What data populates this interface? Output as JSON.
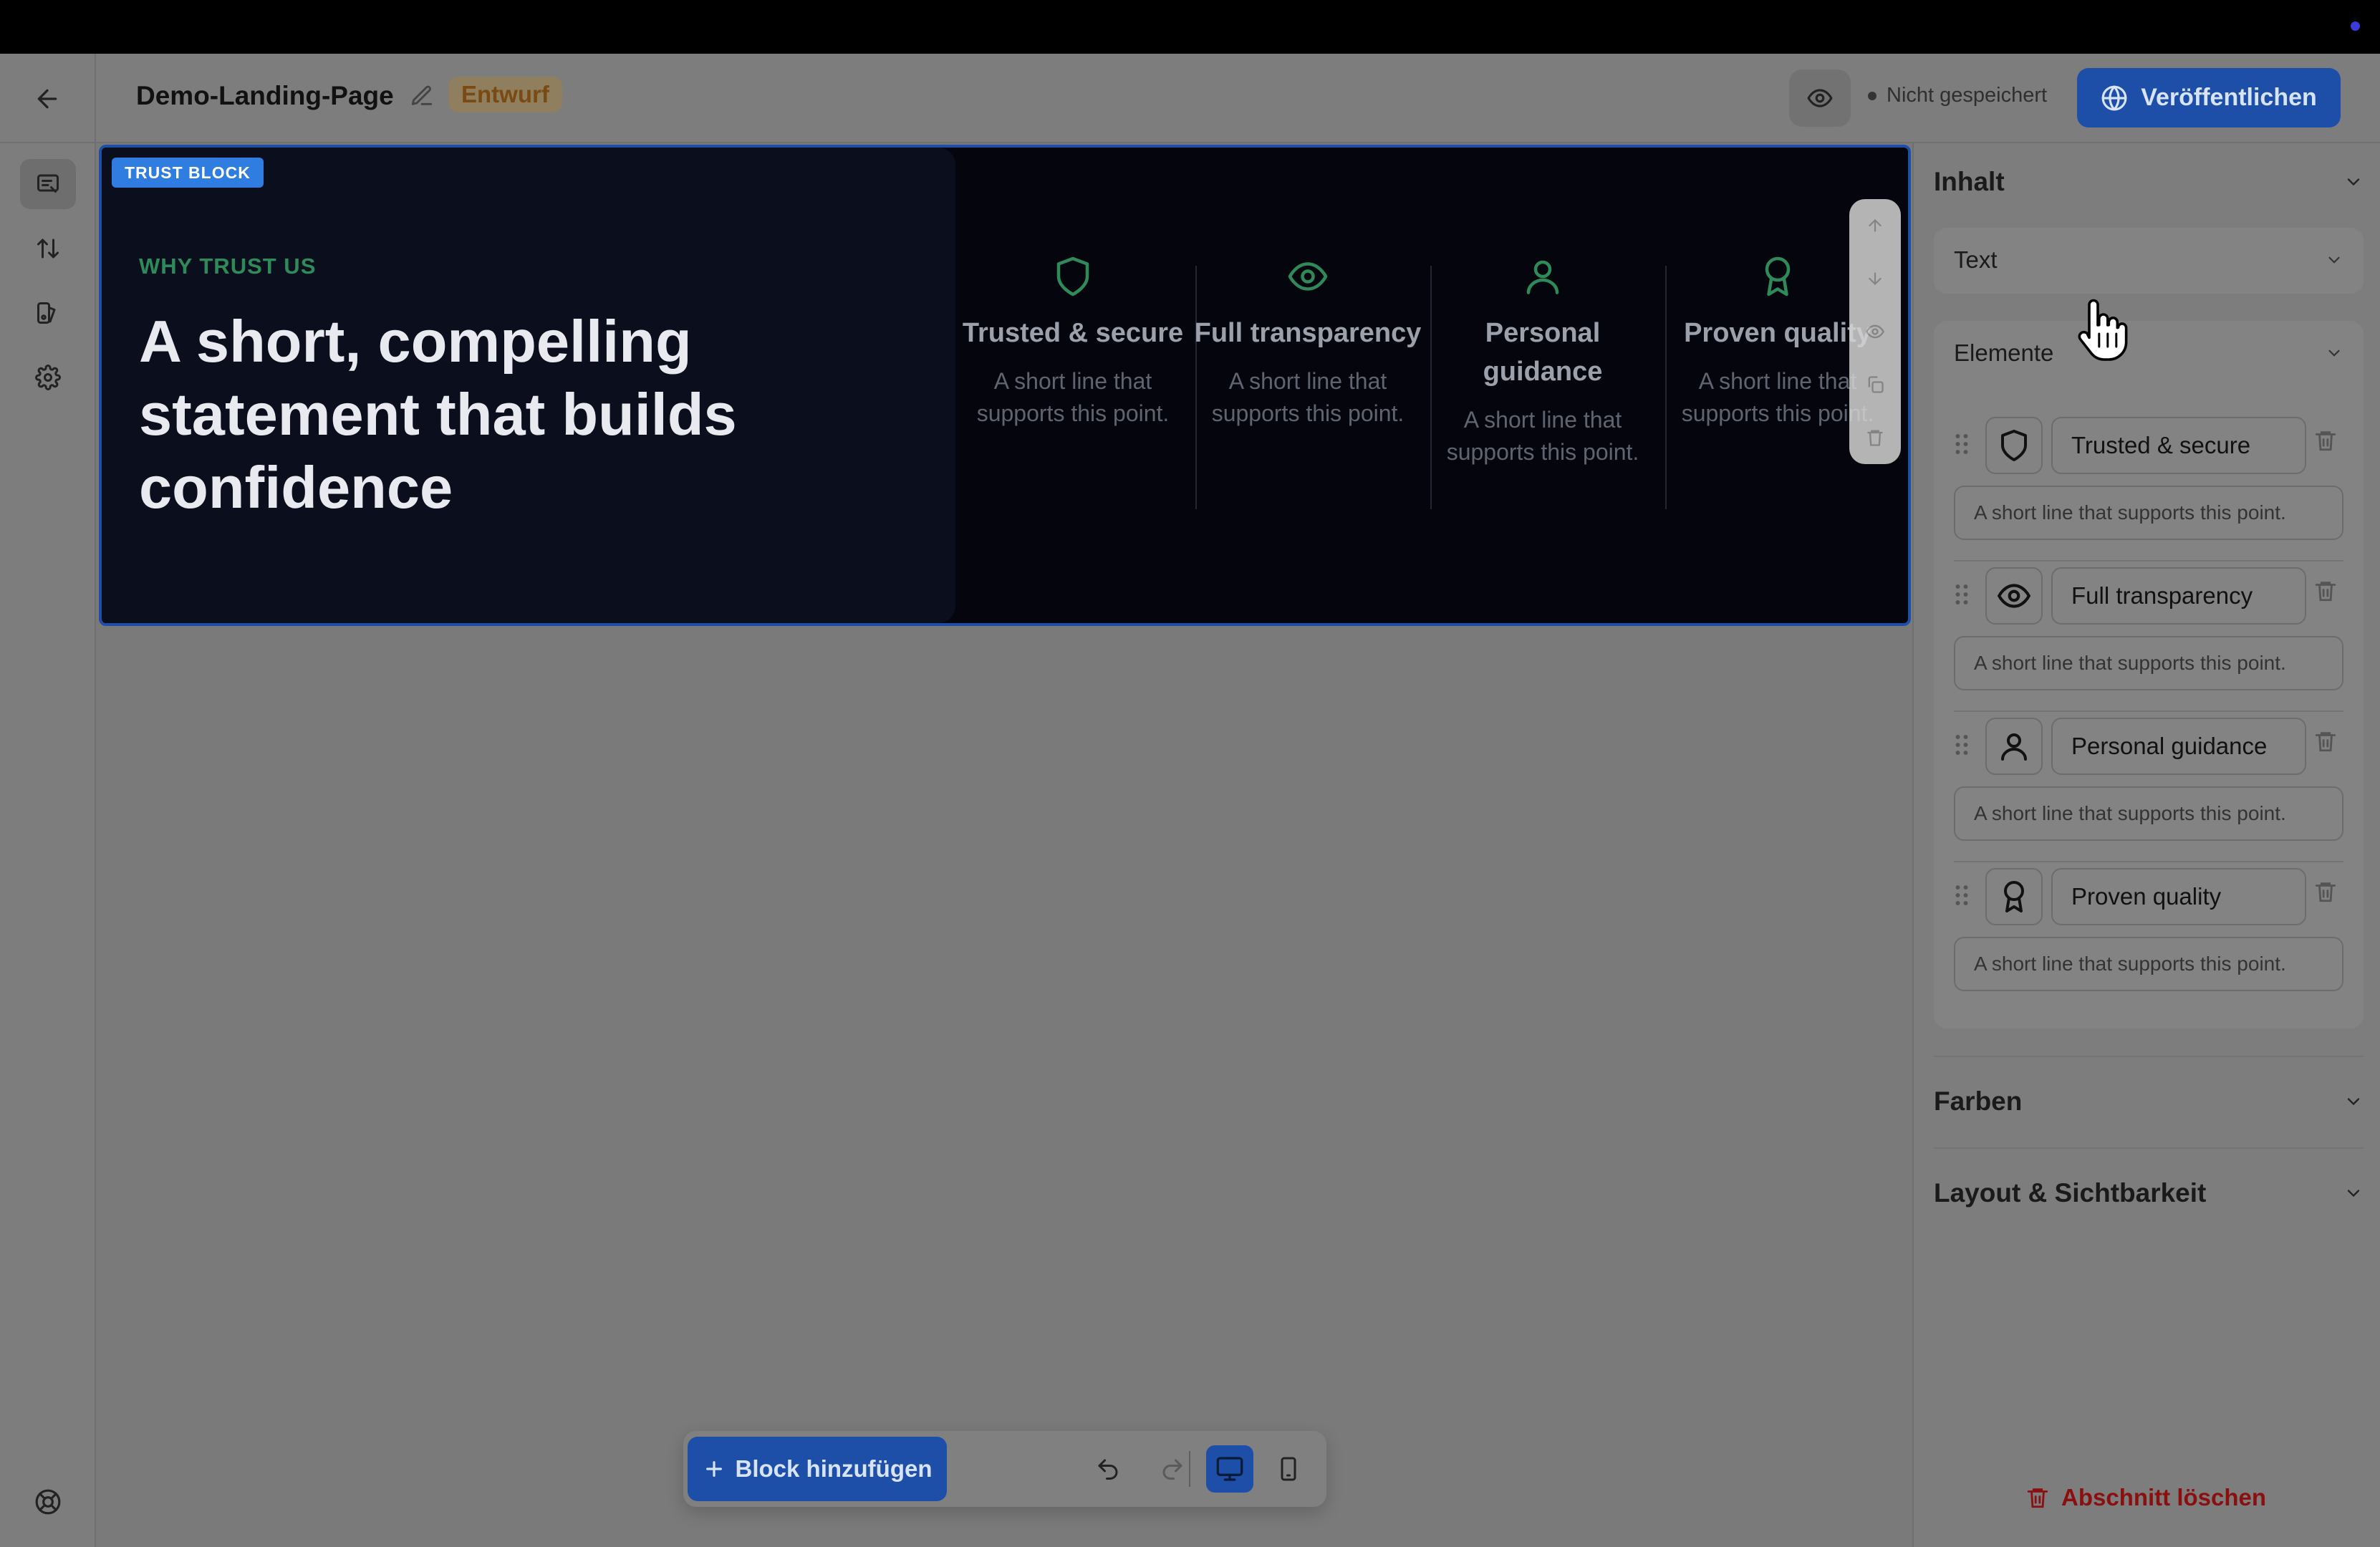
{
  "header": {
    "title": "Demo-Landing-Page",
    "status_badge": "Entwurf",
    "save_status": "Nicht gespeichert",
    "publish_label": "Veröffentlichen"
  },
  "block": {
    "tag": "TRUST BLOCK",
    "eyebrow": "WHY TRUST US",
    "headline": "A short, compelling statement that builds confidence",
    "features": [
      {
        "icon": "shield-icon",
        "title": "Trusted & secure",
        "desc": "A short line that supports this point."
      },
      {
        "icon": "eye-icon",
        "title": "Full transparency",
        "desc": "A short line that supports this point."
      },
      {
        "icon": "user-icon",
        "title": "Personal guidance",
        "desc": "A short line that supports this point."
      },
      {
        "icon": "award-icon",
        "title": "Proven quality",
        "desc": "A short line that supports this point."
      }
    ]
  },
  "toolbar": {
    "add_block_label": "Block hinzufügen"
  },
  "panel": {
    "content_title": "Inhalt",
    "text_title": "Text",
    "elements_title": "Elemente",
    "items": [
      {
        "icon": "shield-icon",
        "title": "Trusted & secure",
        "desc": "A short line that supports this point."
      },
      {
        "icon": "eye-icon",
        "title": "Full transparency",
        "desc": "A short line that supports this point."
      },
      {
        "icon": "user-icon",
        "title": "Personal guidance",
        "desc": "A short line that supports this point."
      },
      {
        "icon": "award-icon",
        "title": "Proven quality",
        "desc": "A short line that supports this point."
      }
    ],
    "colors_title": "Farben",
    "layout_title": "Layout & Sichtbarkeit",
    "delete_section_label": "Abschnitt löschen"
  },
  "colors": {
    "accent": "#1d4fa8",
    "block_background": "#05060d",
    "eyebrow": "#2f8a5a",
    "danger": "#8a1010"
  }
}
